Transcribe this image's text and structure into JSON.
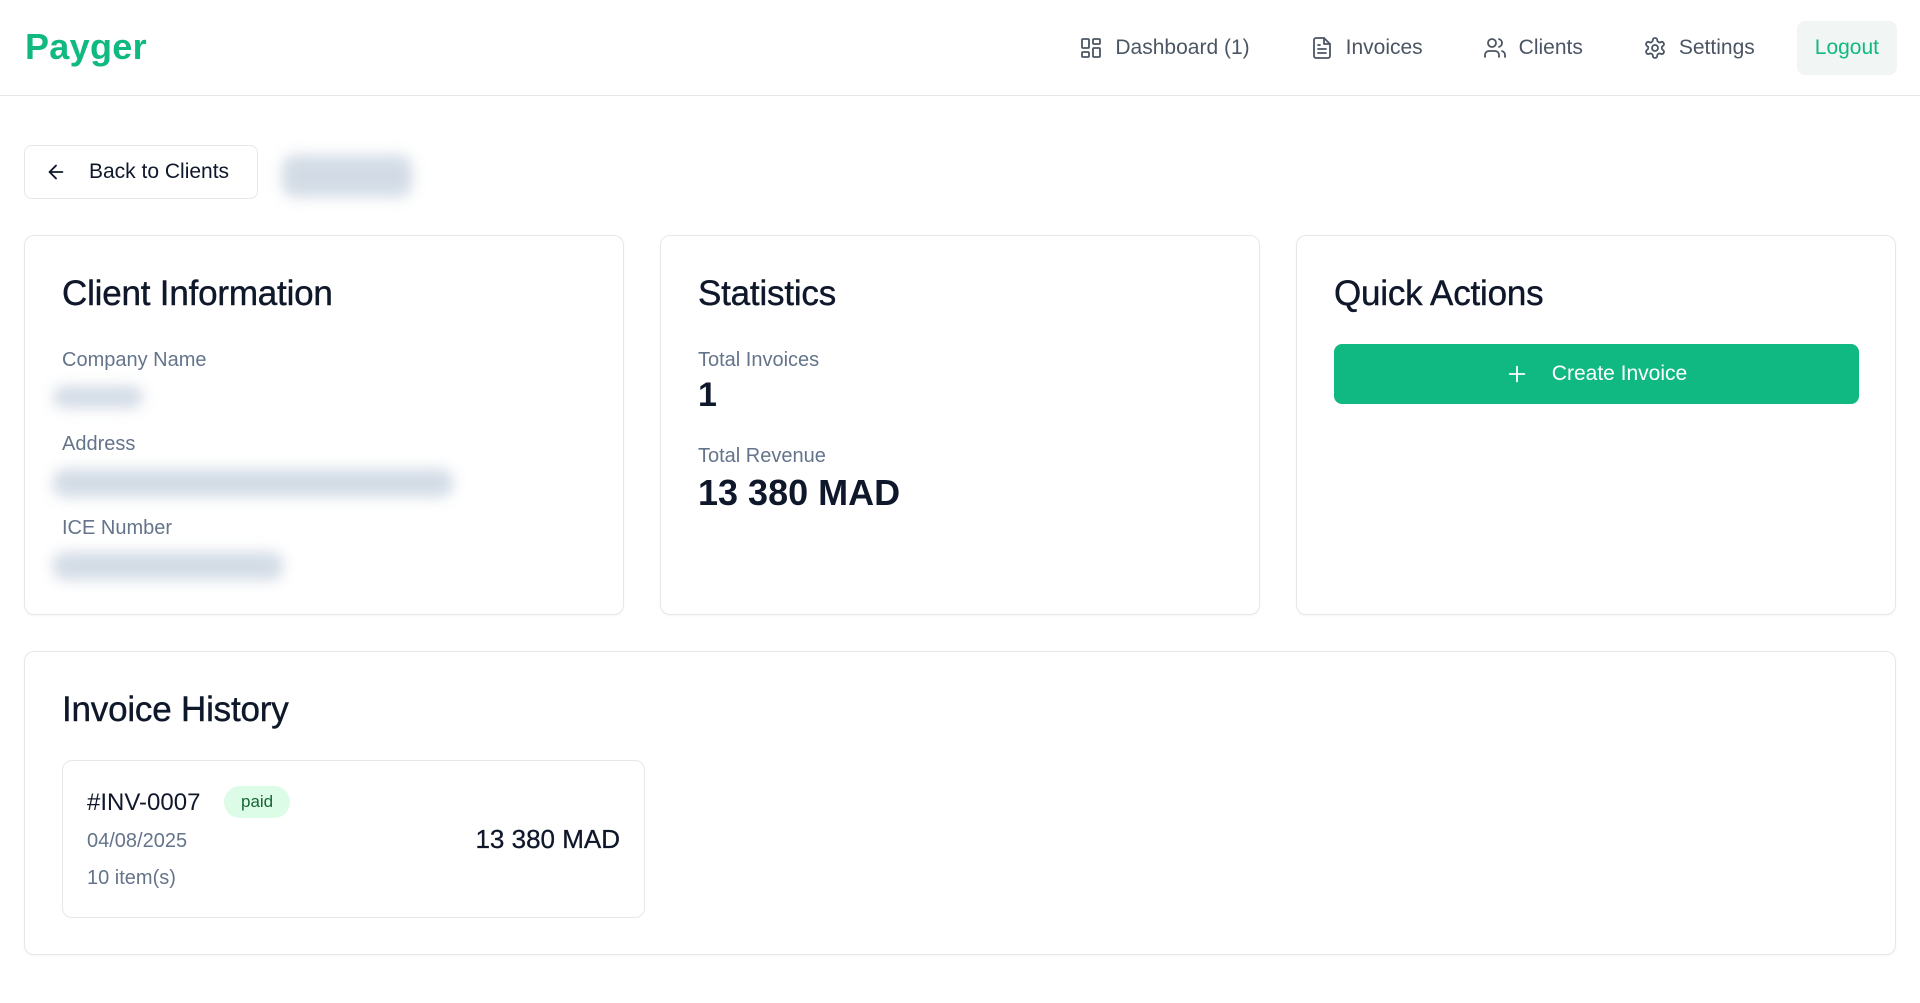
{
  "header": {
    "brand": "Payger",
    "nav": [
      {
        "label": "Dashboard (1)",
        "icon": "dashboard-grid-icon"
      },
      {
        "label": "Invoices",
        "icon": "document-icon"
      },
      {
        "label": "Clients",
        "icon": "users-icon"
      },
      {
        "label": "Settings",
        "icon": "gear-icon"
      }
    ],
    "logout_label": "Logout"
  },
  "back_button": {
    "label": "Back to Clients",
    "icon": "arrow-left-icon"
  },
  "client_info": {
    "title": "Client Information",
    "company_name_label": "Company Name",
    "address_label": "Address",
    "ice_number_label": "ICE Number"
  },
  "statistics": {
    "title": "Statistics",
    "total_invoices_label": "Total Invoices",
    "total_invoices_value": "1",
    "total_revenue_label": "Total Revenue",
    "total_revenue_value": "13 380 MAD"
  },
  "quick_actions": {
    "title": "Quick Actions",
    "create_invoice_label": "Create Invoice",
    "create_invoice_icon": "plus-icon"
  },
  "invoice_history": {
    "title": "Invoice History",
    "invoices": [
      {
        "number": "#INV-0007",
        "status": "paid",
        "date": "04/08/2025",
        "items": "10 item(s)",
        "amount": "13 380 MAD"
      }
    ]
  },
  "colors": {
    "brand": "#10b981",
    "badge_bg": "#dcfce7",
    "badge_text": "#166534",
    "muted_text": "#64748b",
    "border": "#e5e7eb"
  }
}
